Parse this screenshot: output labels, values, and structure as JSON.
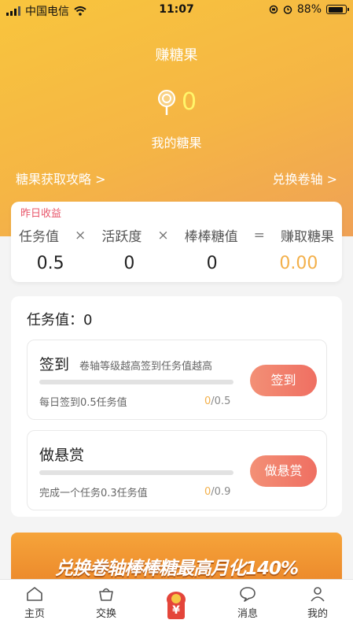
{
  "status_bar": {
    "carrier": "中国电信",
    "time": "11:07",
    "battery_percent": "88%",
    "battery_level": 0.88
  },
  "header": {
    "title": "赚糖果",
    "candy_count": "0",
    "candy_label": "我的糖果",
    "link_left": "糖果获取攻略 >",
    "link_right": "兑换卷轴 >"
  },
  "calc": {
    "tag": "昨日收益",
    "labels": [
      "任务值",
      "活跃度",
      "棒棒糖值",
      "赚取糖果"
    ],
    "operators": [
      "×",
      "×",
      "="
    ],
    "values": [
      "0.5",
      "0",
      "0",
      "0.00"
    ]
  },
  "tasks": {
    "title": "任务值：0",
    "items": [
      {
        "name": "签到",
        "desc": "卷轴等级越高签到任务值越高",
        "sub": "每日签到0.5任务值",
        "current": "0",
        "total": "/0.5",
        "progress": 0,
        "button": "签到"
      },
      {
        "name": "做悬赏",
        "desc": "",
        "sub": "完成一个任务0.3任务值",
        "current": "0",
        "total": "/0.9",
        "progress": 0,
        "button": "做悬赏"
      }
    ]
  },
  "banner": {
    "text": "兑换卷轴棒棒糖最高月化140%"
  },
  "tabbar": {
    "items": [
      {
        "label": "主页",
        "icon": "home-icon"
      },
      {
        "label": "交换",
        "icon": "exchange-basket-icon"
      },
      {
        "label": "",
        "icon": "red-envelope-yuan-icon"
      },
      {
        "label": "消息",
        "icon": "message-icon"
      },
      {
        "label": "我的",
        "icon": "profile-icon"
      }
    ]
  },
  "colors": {
    "header_gradient": [
      "#f8c53d",
      "#efa156"
    ],
    "accent_orange": "#f3b04a",
    "button_gradient": [
      "#f39076",
      "#ef6f62"
    ],
    "tag_red": "#e8566a"
  }
}
